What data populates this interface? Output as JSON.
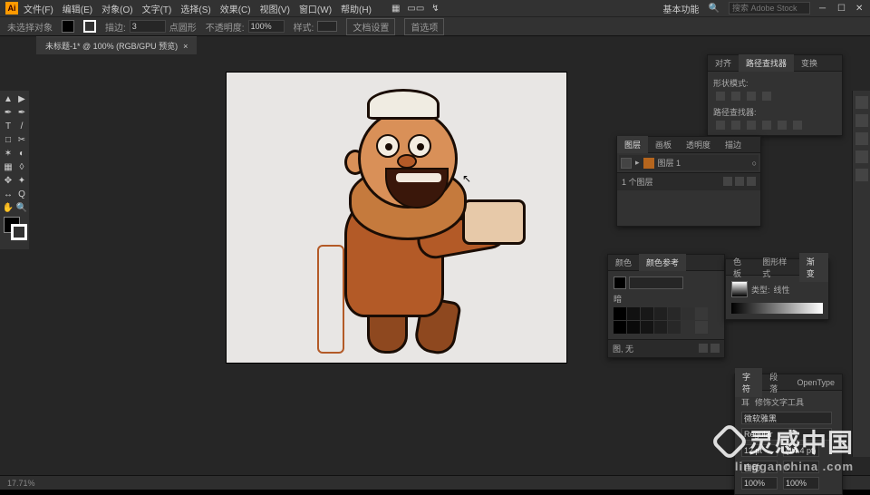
{
  "app": {
    "logo": "Ai"
  },
  "menubar": [
    "文件(F)",
    "编辑(E)",
    "对象(O)",
    "文字(T)",
    "选择(S)",
    "效果(C)",
    "视图(V)",
    "窗口(W)",
    "帮助(H)"
  ],
  "workspace": {
    "label": "基本功能",
    "searchPlaceholder": "搜索 Adobe Stock"
  },
  "controlbar": {
    "noSelection": "未选择对象",
    "strokeLabel": "描边:",
    "strokeValue": "3",
    "strokeUnit": "点圆形",
    "opacityLabel": "不透明度:",
    "opacityValue": "100%",
    "styleLabel": "样式:",
    "docSetup": "文档设置",
    "prefs": "首选项"
  },
  "documentTab": "未标题-1* @ 100% (RGB/GPU 预览)",
  "toolbox": [
    "▲",
    "▶",
    "✒",
    "✒",
    "T",
    "/",
    "□",
    "✂",
    "✶",
    "◐",
    "▦",
    "◊",
    "✥",
    "✦",
    "↔",
    "Q",
    "✋",
    "🔍"
  ],
  "panels": {
    "align": {
      "tabs": [
        "对齐",
        "路径查找器",
        "变换"
      ],
      "active": 1,
      "section1": "形状模式:",
      "section2": "路径查找器:"
    },
    "layers": {
      "tabs": [
        "图层",
        "画板",
        "透明度",
        "描边"
      ],
      "active": 0,
      "layerName": "图层 1",
      "count": "1 个图层"
    },
    "color": {
      "tabs": [
        "颜色",
        "颜色参考"
      ],
      "active": 1,
      "hint": "暗"
    },
    "swatches": {
      "tabs": [
        "色板",
        "图形样式",
        "渐变"
      ],
      "active": 2,
      "typeLabel": "类型:",
      "typeValue": "线性"
    },
    "character": {
      "tabs": [
        "字符",
        "段落",
        "OpenType"
      ],
      "active": 0,
      "touchType": "修饰文字工具",
      "font": "微软雅黑",
      "style": "Regular",
      "size": "12 pt",
      "leading": "(14.4 pt)",
      "tracking": "0",
      "kerning": "自动",
      "hScale": "100%",
      "vScale": "100%"
    },
    "colorFooter": "图, 无"
  },
  "status": {
    "zoom": "17.71%"
  },
  "watermark": {
    "big": "灵感中国",
    "small": "lingganchina .com"
  }
}
